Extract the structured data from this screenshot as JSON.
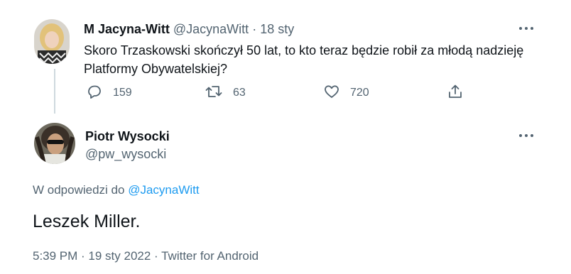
{
  "parent_tweet": {
    "author_name": "M Jacyna-Witt",
    "handle": "@JacynaWitt",
    "separator": "·",
    "date": "18 sty",
    "text": "Skoro Trzaskowski skończył 50 lat, to kto teraz będzie robił za młodą nadzieję Platformy Obywatelskiej?",
    "replies_count": "159",
    "retweets_count": "63",
    "likes_count": "720"
  },
  "reply_tweet": {
    "author_name": "Piotr Wysocki",
    "handle": "@pw_wysocki",
    "reply_label": "W odpowiedzi do",
    "reply_mention": "@JacynaWitt",
    "text": "Leszek Miller.",
    "timestamp": "5:39 PM · 19 sty 2022 · Twitter for Android"
  },
  "icons": {
    "reply": "reply-icon",
    "retweet": "retweet-icon",
    "like": "heart-icon",
    "share": "share-icon",
    "more": "more-icon"
  },
  "colors": {
    "text_primary": "#0f1419",
    "text_secondary": "#536471",
    "link": "#1d9bf0",
    "thread_line": "#cfd9de"
  }
}
